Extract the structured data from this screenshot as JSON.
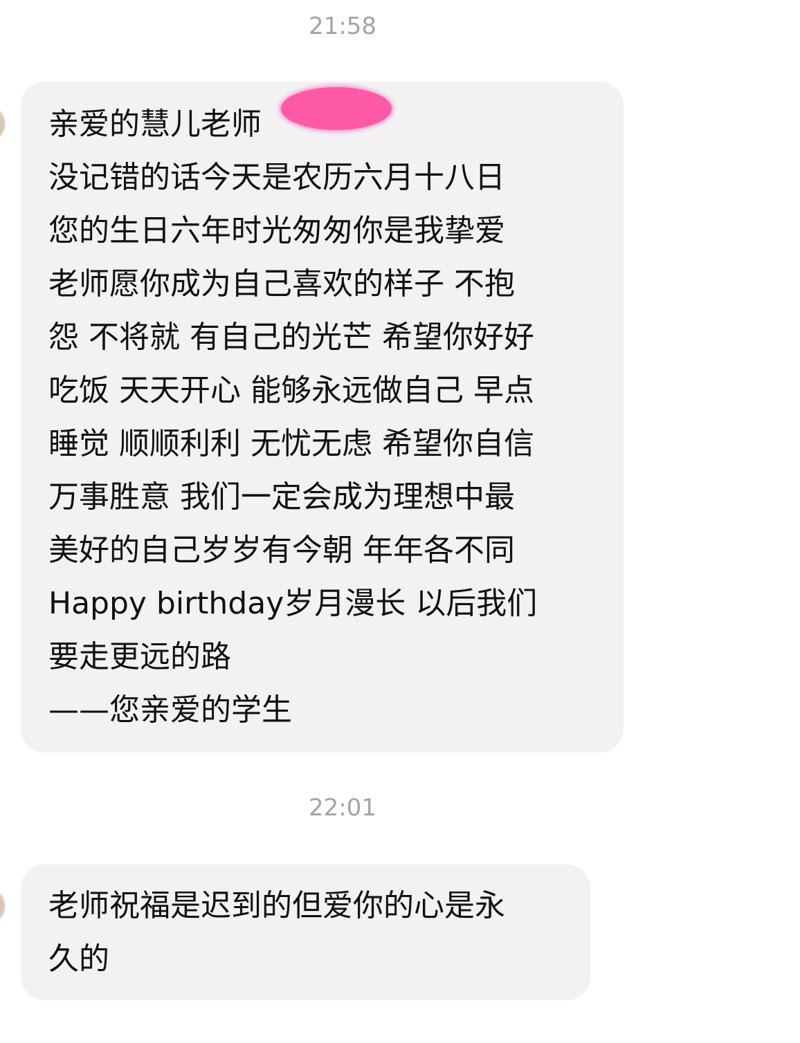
{
  "conversation": {
    "timestamp_1": "21:58",
    "message_1": {
      "lines": [
        "亲爱的慧儿老师",
        "没记错的话今天是农历六月十八日",
        "您的生日六年时光匆匆你是我挚爱",
        "老师愿你成为自己喜欢的样子 不抱",
        "怨 不将就 有自己的光芒 希望你好好",
        "吃饭 天天开心 能够永远做自己 早点",
        "睡觉 顺顺利利 无忧无虑 希望你自信",
        "万事胜意 我们一定会成为理想中最",
        "美好的自己岁岁有今朝 年年各不同",
        "Happy birthday岁月漫长 以后我们",
        "要走更远的路"
      ],
      "signature": "——您亲爱的学生",
      "redaction_color": "#ff5aa8"
    },
    "timestamp_2": "22:01",
    "message_2": {
      "lines": [
        "老师祝福是迟到的但爱你的心是永",
        "久的"
      ]
    }
  },
  "colors": {
    "bubble_background": "#f2f2f4",
    "timestamp_text": "#a3a3a8",
    "message_text": "#111111"
  }
}
